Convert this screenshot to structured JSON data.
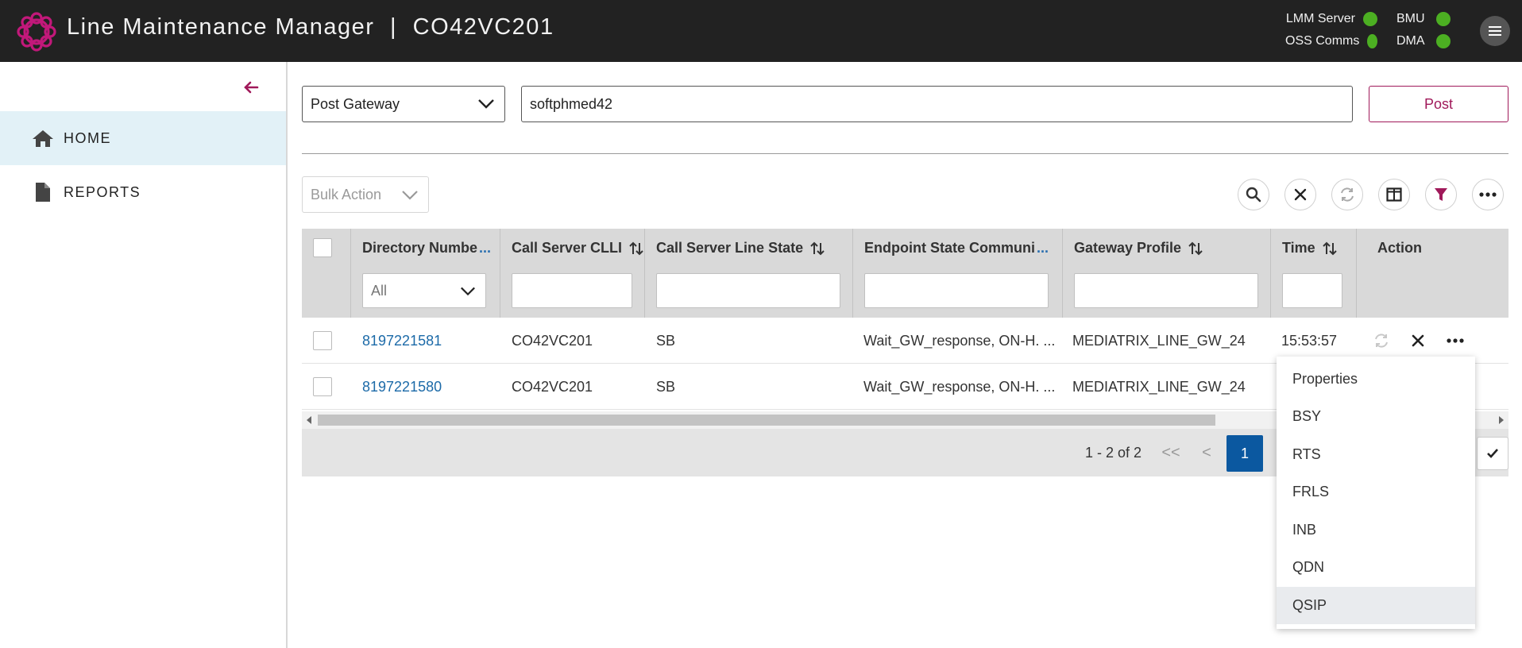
{
  "app": {
    "title": "Line Maintenance Manager",
    "separator": "|",
    "site": "CO42VC201"
  },
  "status": [
    {
      "label": "LMM Server",
      "state": "ok"
    },
    {
      "label": "BMU",
      "state": "ok"
    },
    {
      "label": "OSS Comms",
      "state": "ok"
    },
    {
      "label": "DMA",
      "state": "ok"
    }
  ],
  "colors": {
    "header_bg": "#222222",
    "accent": "#a0195a",
    "status_ok": "#4caf22",
    "link": "#1c6aa8",
    "page_active": "#0b58a0",
    "nav_active_bg": "#e2f1f7"
  },
  "sidebar": {
    "items": [
      {
        "label": "HOME",
        "icon": "home-icon",
        "active": true
      },
      {
        "label": "REPORTS",
        "icon": "document-icon",
        "active": false
      }
    ]
  },
  "post": {
    "gateway_select": "Post Gateway",
    "input_value": "softphmed42",
    "button_label": "Post"
  },
  "toolbar": {
    "bulk_action": "Bulk Action",
    "icons": [
      "search-icon",
      "clear-icon",
      "refresh-icon",
      "columns-icon",
      "filter-icon",
      "more-icon"
    ]
  },
  "table": {
    "columns": [
      {
        "label": "Directory Numbe",
        "ellipsis": "..."
      },
      {
        "label": "Call Server CLLI",
        "ellipsis": ""
      },
      {
        "label": "Call Server Line State",
        "ellipsis": ""
      },
      {
        "label": "Endpoint State Communi",
        "ellipsis": "..."
      },
      {
        "label": "Gateway Profile",
        "ellipsis": ""
      },
      {
        "label": "Time",
        "ellipsis": ""
      },
      {
        "label": "Action",
        "ellipsis": ""
      }
    ],
    "dn_filter": "All",
    "rows": [
      {
        "dn": "8197221581",
        "clli": "CO42VC201",
        "line_state": "SB",
        "endpoint_state": "Wait_GW_response, ON-H. ...",
        "gateway_profile": "MEDIATRIX_LINE_GW_24",
        "time": "15:53:57"
      },
      {
        "dn": "8197221580",
        "clli": "CO42VC201",
        "line_state": "SB",
        "endpoint_state": "Wait_GW_response, ON-H. ...",
        "gateway_profile": "MEDIATRIX_LINE_GW_24",
        "time": ""
      }
    ]
  },
  "pager": {
    "range": "1 - 2 of 2",
    "first": "<<",
    "prev": "<",
    "current": "1"
  },
  "action_menu": {
    "items": [
      "Properties",
      "BSY",
      "RTS",
      "FRLS",
      "INB",
      "QDN",
      "QSIP"
    ],
    "highlighted": "QSIP"
  }
}
